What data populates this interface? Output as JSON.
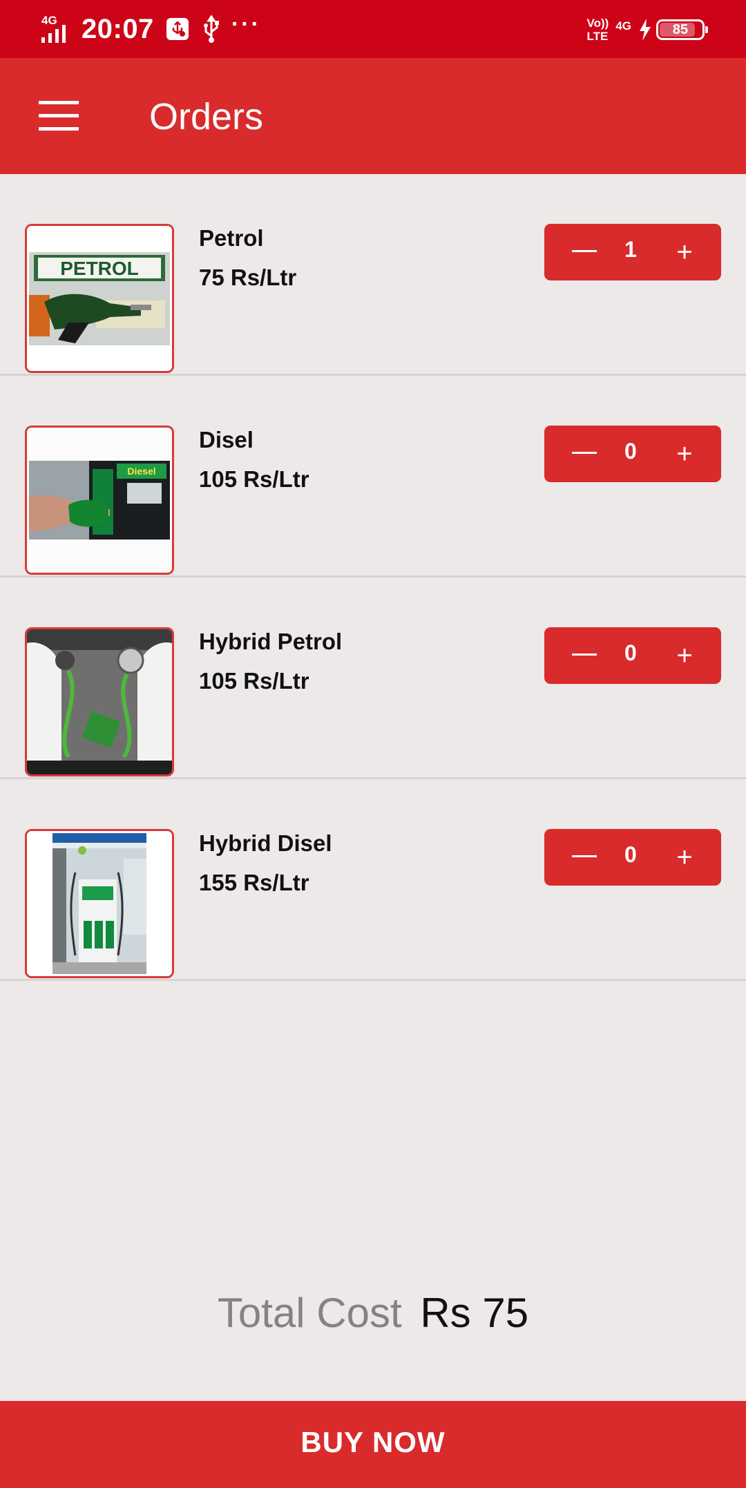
{
  "status_bar": {
    "network_type": "4G",
    "time": "20:07",
    "overflow": "···",
    "volte": "Vo))\nLTE",
    "data_type": "4G",
    "battery": "85",
    "battery_level": 0.85,
    "icons": [
      "signal-icon",
      "usb-debug-icon",
      "usb-icon",
      "volte-icon",
      "charging-icon",
      "battery-icon"
    ]
  },
  "app_bar": {
    "title": "Orders",
    "menu_icon": "hamburger-menu-icon",
    "color": "#d92b2c"
  },
  "orders": [
    {
      "name": "Petrol",
      "price": "75 Rs/Ltr",
      "quantity": "1",
      "image": "petrol-nozzle-image"
    },
    {
      "name": "Disel",
      "price": "105 Rs/Ltr",
      "quantity": "0",
      "image": "diesel-nozzle-image"
    },
    {
      "name": "Hybrid Petrol",
      "price": "105 Rs/Ltr",
      "quantity": "0",
      "image": "ev-charging-image"
    },
    {
      "name": "Hybrid Disel",
      "price": "155 Rs/Ltr",
      "quantity": "0",
      "image": "fuel-pump-station-image"
    }
  ],
  "stepper": {
    "plus": "+"
  },
  "total": {
    "label": "Total Cost",
    "value": "Rs 75"
  },
  "buy_button": {
    "label": "BUY NOW"
  },
  "colors": {
    "accent": "#d92b2c",
    "status_bar": "#cd0318",
    "background": "#ece9e8"
  }
}
